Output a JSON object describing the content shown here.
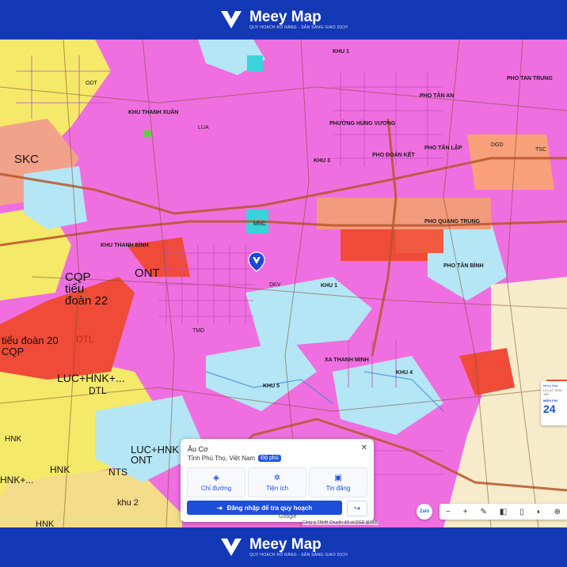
{
  "header": {
    "brand": "Meey Map",
    "tagline": "QUY HOẠCH RÕ RÀNG - SẴN SÀNG GIAO DỊCH"
  },
  "footer": {
    "brand": "Meey Map",
    "tagline": "QUY HOẠCH RÕ RÀNG - SẴN SÀNG GIAO DỊCH"
  },
  "map": {
    "labels": {
      "skc": "SKC",
      "ont": "ONT",
      "cqp_tieu_doan_22": "CQP\ntiểu\nđoàn 22",
      "tieu_doan_20": "tiểu đoàn 20\nCQP",
      "dtl_1": "DTL",
      "dtl_2": "DTL",
      "luc_hnk": "LUC+HNK+...",
      "luc_hnk_ont": "LUC+HNK\nONT",
      "hnk_1": "HNK",
      "hnk_2": "HNK",
      "nts_1": "NTS",
      "khu_2": "khu 2",
      "hnk_plus": "HNK+...",
      "hnk_left": "HNK",
      "cqp_mid": "CQP",
      "khu1": "KHU 1",
      "khu3": "KHU 3",
      "khu4": "KHU 4",
      "khu5": "KHU 5",
      "khu1b": "KHU 1",
      "pho_tan_trung": "PHO TAN TRUNG",
      "pho_tan_an": "PHO TÂN AN",
      "phuong_hung_vuong": "PHƯỜNG HÙNG VƯƠNG",
      "pho_doan_ket": "PHO ĐOÀN KẾT",
      "pho_tan_lap": "PHO TÂN LẬP",
      "pho_quang_trung": "PHO QUANG TRUNG",
      "pho_tan_binh": "PHO TÂN BÌNH",
      "khu_thanh_xuan": "KHU THANH XUÂN",
      "khu_thanh_binh": "KHU THANH BÌNH",
      "xa_thanh_minh": "XA THANH MINH",
      "odt": "ODT",
      "dgd": "DGD",
      "tsc": "TSC",
      "mnc": "MNC",
      "tmd": "TMD",
      "dkv": "DKV",
      "lua": "LUA"
    }
  },
  "popup": {
    "title": "Âu Cơ",
    "location": "Tỉnh Phú Thọ, Việt Nam",
    "badge": "Độ phủ",
    "actions": [
      "Chỉ đường",
      "Tiện ích",
      "Tin đăng"
    ],
    "login": "Đăng nhập để tra quy hoạch"
  },
  "controls": {
    "zalo": "Zalo",
    "toolbar": [
      "−",
      "+",
      "✎",
      "◧",
      "▯",
      "◐",
      "⊕"
    ]
  },
  "sidecard": {
    "line1": "Meey Map",
    "line2": "Lũ LỤT SƠN TÂY",
    "line3": "MIỀN PHÍ",
    "line4": "24"
  },
  "attribution": {
    "google": "Google",
    "text": "Công ty TNHH Chuyển đổi số ĐGĐ @2025"
  }
}
